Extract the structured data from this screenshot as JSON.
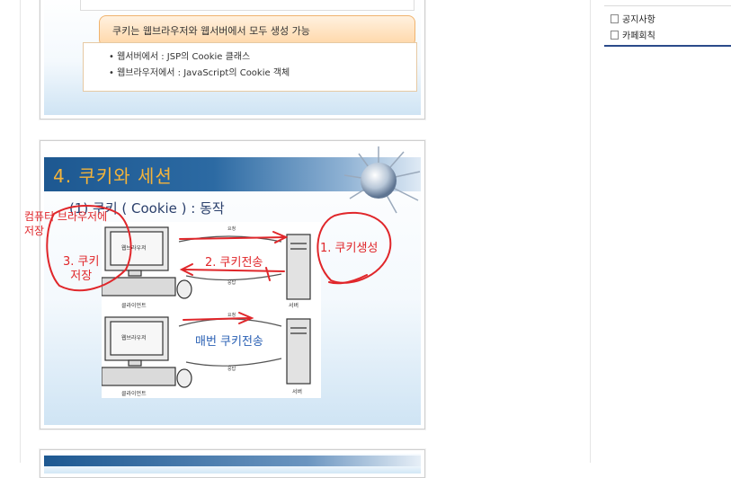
{
  "slide_top": {
    "highlight": "쿠키는 웹브라우저와 웹서버에서 모두 생성 가능",
    "bullets": [
      "• 웹서버에서 : JSP의 Cookie 클래스",
      "• 웹브라우저에서 : JavaScript의 Cookie 객체"
    ]
  },
  "slide_main": {
    "title": "4. 쿠키와 세션",
    "subtitle": "(1) 쿠키 ( Cookie ) : 동작",
    "diagram": {
      "browser_label": "웹브라우저",
      "client_label": "클라이언트",
      "server_label": "서버",
      "request_label": "요청",
      "response_label": "응답"
    },
    "annotations": {
      "step1": "1. 쿠키생성",
      "step2": "2. 쿠키전송",
      "step3": "3. 쿠키\n저장",
      "margin_note": "컴퓨터 브라우저에\n저장",
      "every_time": "매번 쿠키전송"
    }
  },
  "sidebar": {
    "items": [
      "공지사항",
      "카페회칙"
    ]
  },
  "colors": {
    "annotation_red": "#e0262a",
    "title_orange": "#f5b43a",
    "title_band": "#1d5891",
    "sidebar_rule": "#2b4a8a"
  }
}
